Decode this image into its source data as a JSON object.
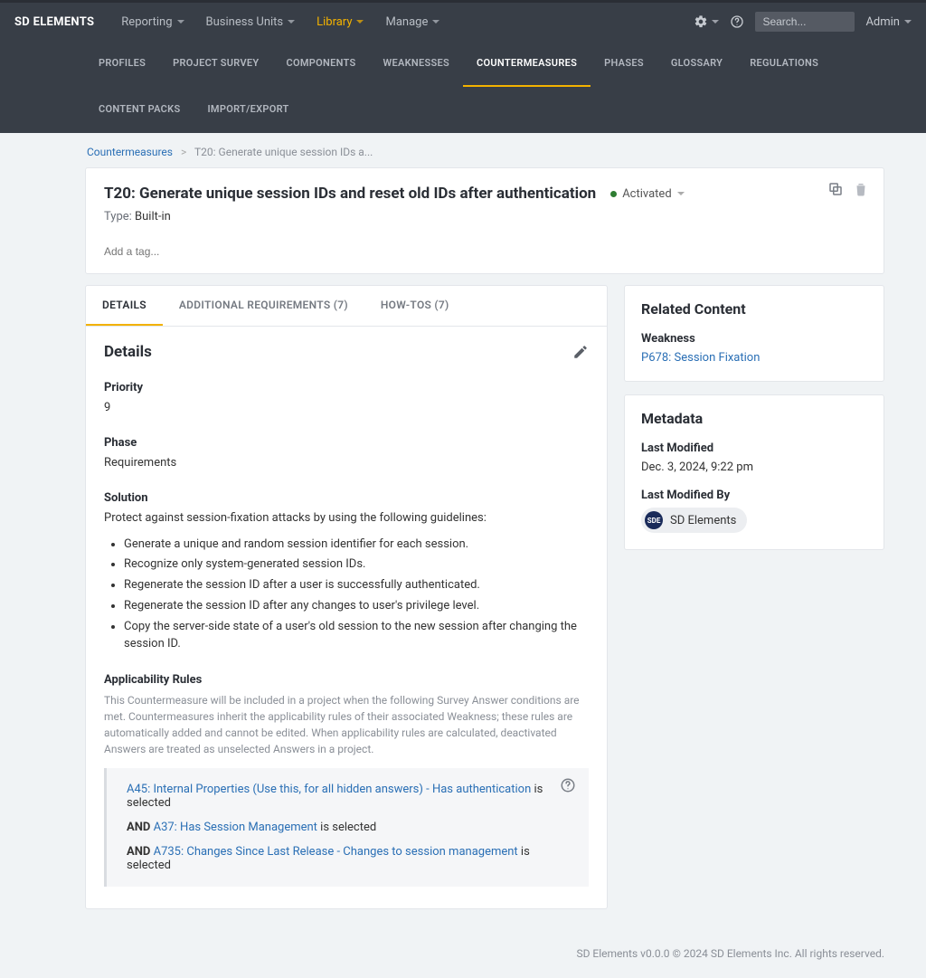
{
  "app": {
    "logo": "SD ELEMENTS"
  },
  "mainnav": [
    {
      "label": "Reporting",
      "active": false
    },
    {
      "label": "Business Units",
      "active": false
    },
    {
      "label": "Library",
      "active": true
    },
    {
      "label": "Manage",
      "active": false
    }
  ],
  "search": {
    "placeholder": "Search..."
  },
  "admin_label": "Admin",
  "subnav": [
    {
      "label": "PROFILES",
      "active": false
    },
    {
      "label": "PROJECT SURVEY",
      "active": false
    },
    {
      "label": "COMPONENTS",
      "active": false
    },
    {
      "label": "WEAKNESSES",
      "active": false
    },
    {
      "label": "COUNTERMEASURES",
      "active": true
    },
    {
      "label": "PHASES",
      "active": false
    },
    {
      "label": "GLOSSARY",
      "active": false
    },
    {
      "label": "REGULATIONS",
      "active": false
    },
    {
      "label": "CONTENT PACKS",
      "active": false
    },
    {
      "label": "IMPORT/EXPORT",
      "active": false
    }
  ],
  "breadcrumb": {
    "root": "Countermeasures",
    "current": "T20: Generate unique session IDs a..."
  },
  "header": {
    "title": "T20: Generate unique session IDs and reset old IDs after authentication",
    "status": "Activated",
    "type_label": "Type:",
    "type_value": "Built-in",
    "tag_placeholder": "Add a tag..."
  },
  "tabs": [
    {
      "label": "DETAILS",
      "active": true
    },
    {
      "label": "ADDITIONAL REQUIREMENTS (7)",
      "active": false
    },
    {
      "label": "HOW-TOS (7)",
      "active": false
    }
  ],
  "details": {
    "heading": "Details",
    "priority_label": "Priority",
    "priority_value": "9",
    "phase_label": "Phase",
    "phase_value": "Requirements",
    "solution_label": "Solution",
    "solution_intro": "Protect against session-fixation attacks by using the following guidelines:",
    "solution_items": [
      "Generate a unique and random session identifier for each session.",
      "Recognize only system-generated session IDs.",
      "Regenerate the session ID after a user is successfully authenticated.",
      "Regenerate the session ID after any changes to user's privilege level.",
      "Copy the server-side state of a user's old session to the new session after changing the session ID."
    ],
    "applicability_label": "Applicability Rules",
    "applicability_help": "This Countermeasure will be included in a project when the following Survey Answer conditions are met. Countermeasures inherit the applicability rules of their associated Weakness; these rules are automatically added and cannot be edited. When applicability rules are calculated, deactivated Answers are treated as unselected Answers in a project.",
    "rules": [
      {
        "prefix": "",
        "link": "A45: Internal Properties (Use this, for all hidden answers) - Has authentication",
        "suffix": " is selected"
      },
      {
        "prefix": "AND ",
        "link": "A37: Has Session Management",
        "suffix": " is selected"
      },
      {
        "prefix": "AND ",
        "link": "A735: Changes Since Last Release - Changes to session management",
        "suffix": " is selected"
      }
    ]
  },
  "related": {
    "title": "Related Content",
    "weakness_label": "Weakness",
    "weakness_link": "P678: Session Fixation"
  },
  "metadata": {
    "title": "Metadata",
    "last_modified_label": "Last Modified",
    "last_modified_value": "Dec. 3, 2024, 9:22 pm",
    "last_modified_by_label": "Last Modified By",
    "last_modified_by_value": "SD Elements",
    "avatar_initials": "SDE"
  },
  "footer": "SD Elements v0.0.0 © 2024 SD Elements Inc. All rights reserved."
}
